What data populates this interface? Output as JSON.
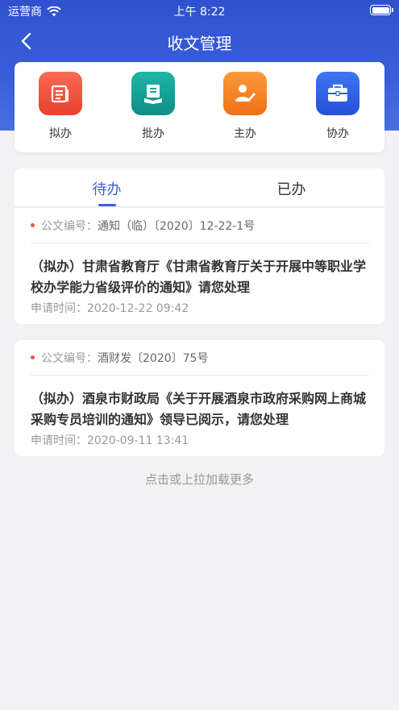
{
  "status_bar": {
    "carrier": "运营商",
    "time": "上午 8:22"
  },
  "nav": {
    "title": "收文管理"
  },
  "quick_actions": [
    {
      "label": "拟办",
      "icon": "draft-icon",
      "color": "#f0533f"
    },
    {
      "label": "批办",
      "icon": "approve-book-icon",
      "color": "#17a398"
    },
    {
      "label": "主办",
      "icon": "host-person-icon",
      "color": "#f57f22"
    },
    {
      "label": "协办",
      "icon": "briefcase-icon",
      "color": "#2f5fe0"
    }
  ],
  "tabs": [
    {
      "label": "待办",
      "active": true
    },
    {
      "label": "已办",
      "active": false
    }
  ],
  "documents": [
    {
      "no_label": "公文编号：",
      "no_value": "通知（临）〔2020〕12-22-1号",
      "title": "（拟办）甘肃省教育厅《甘肃省教育厅关于开展中等职业学校办学能力省级评价的通知》请您处理",
      "time_label": "申请时间：",
      "time_value": "2020-12-22 09:42"
    },
    {
      "no_label": "公文编号：",
      "no_value": "酒财发〔2020〕75号",
      "title": "（拟办）酒泉市财政局《关于开展酒泉市政府采购网上商城采购专员培训的通知》领导已阅示，请您处理",
      "time_label": "申请时间：",
      "time_value": "2020-09-11 13:41"
    }
  ],
  "load_more": "点击或上拉加载更多",
  "colors": {
    "primary": "#3a5fd9",
    "accent_dot": "#e05a4f"
  }
}
